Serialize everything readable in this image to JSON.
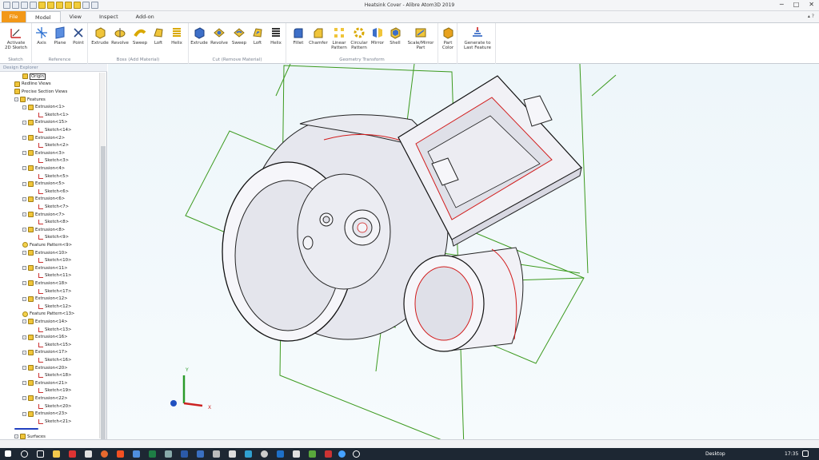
{
  "window": {
    "title": "Heatsink Cover - Alibre Atom3D 2019",
    "controls": {
      "minimize": "─",
      "maximize": "□",
      "close": "✕"
    }
  },
  "tabs": [
    {
      "label": "File"
    },
    {
      "label": "Model"
    },
    {
      "label": "View"
    },
    {
      "label": "Inspect"
    },
    {
      "label": "Add-on"
    }
  ],
  "ribbon": {
    "groups": [
      {
        "label": "Sketch",
        "buttons": [
          "Activate 2D Sketch"
        ]
      },
      {
        "label": "Reference",
        "buttons": [
          "Axis",
          "Plane",
          "Point"
        ]
      },
      {
        "label": "Boss (Add Material)",
        "buttons": [
          "Extrude",
          "Revolve",
          "Sweep",
          "Loft",
          "Helix"
        ]
      },
      {
        "label": "Cut (Remove Material)",
        "buttons": [
          "Extrude",
          "Revolve",
          "Sweep",
          "Loft",
          "Helix"
        ]
      },
      {
        "label": "Geometry Transform",
        "buttons": [
          "Fillet",
          "Chamfer",
          "Linear Pattern",
          "Circular Pattern",
          "Mirror",
          "Shell",
          "Scale/Mirror Part"
        ]
      },
      {
        "label": "",
        "buttons": [
          "Part Color"
        ]
      },
      {
        "label": "",
        "buttons": [
          "Generate to Last Feature"
        ]
      }
    ]
  },
  "explorer": {
    "header": "Design Explorer",
    "items": [
      {
        "label": "Origin",
        "type": "origin",
        "level": 2
      },
      {
        "label": "Redline Views",
        "type": "view",
        "level": 1
      },
      {
        "label": "Precise Section Views",
        "type": "view",
        "level": 1
      },
      {
        "label": "Features",
        "type": "folder",
        "level": 1
      },
      {
        "label": "Extrusion<1>",
        "type": "feat",
        "level": 2
      },
      {
        "label": "Sketch<1>",
        "type": "sk",
        "level": 3
      },
      {
        "label": "Extrusion<15>",
        "type": "feat",
        "level": 2
      },
      {
        "label": "Sketch<14>",
        "type": "sk",
        "level": 3
      },
      {
        "label": "Extrusion<2>",
        "type": "feat",
        "level": 2
      },
      {
        "label": "Sketch<2>",
        "type": "sk",
        "level": 3
      },
      {
        "label": "Extrusion<3>",
        "type": "feat",
        "level": 2
      },
      {
        "label": "Sketch<3>",
        "type": "sk",
        "level": 3
      },
      {
        "label": "Extrusion<4>",
        "type": "feat",
        "level": 2
      },
      {
        "label": "Sketch<5>",
        "type": "sk",
        "level": 3
      },
      {
        "label": "Extrusion<5>",
        "type": "feat",
        "level": 2
      },
      {
        "label": "Sketch<6>",
        "type": "sk",
        "level": 3
      },
      {
        "label": "Extrusion<6>",
        "type": "feat",
        "level": 2
      },
      {
        "label": "Sketch<7>",
        "type": "sk",
        "level": 3
      },
      {
        "label": "Extrusion<7>",
        "type": "feat",
        "level": 2
      },
      {
        "label": "Sketch<8>",
        "type": "sk",
        "level": 3
      },
      {
        "label": "Extrusion<8>",
        "type": "feat",
        "level": 2
      },
      {
        "label": "Sketch<9>",
        "type": "sk",
        "level": 3
      },
      {
        "label": "Feature Pattern<9>",
        "type": "pat",
        "level": 2
      },
      {
        "label": "Extrusion<10>",
        "type": "feat",
        "level": 2
      },
      {
        "label": "Sketch<10>",
        "type": "sk",
        "level": 3
      },
      {
        "label": "Extrusion<11>",
        "type": "feat",
        "level": 2
      },
      {
        "label": "Sketch<11>",
        "type": "sk",
        "level": 3
      },
      {
        "label": "Extrusion<18>",
        "type": "feat",
        "level": 2
      },
      {
        "label": "Sketch<17>",
        "type": "sk",
        "level": 3
      },
      {
        "label": "Extrusion<12>",
        "type": "feat",
        "level": 2
      },
      {
        "label": "Sketch<12>",
        "type": "sk",
        "level": 3
      },
      {
        "label": "Feature Pattern<13>",
        "type": "pat",
        "level": 2
      },
      {
        "label": "Extrusion<14>",
        "type": "feat",
        "level": 2
      },
      {
        "label": "Sketch<13>",
        "type": "sk",
        "level": 3
      },
      {
        "label": "Extrusion<16>",
        "type": "feat",
        "level": 2
      },
      {
        "label": "Sketch<15>",
        "type": "sk",
        "level": 3
      },
      {
        "label": "Extrusion<17>",
        "type": "feat",
        "level": 2
      },
      {
        "label": "Sketch<16>",
        "type": "sk",
        "level": 3
      },
      {
        "label": "Extrusion<20>",
        "type": "feat",
        "level": 2
      },
      {
        "label": "Sketch<18>",
        "type": "sk",
        "level": 3
      },
      {
        "label": "Extrusion<21>",
        "type": "feat",
        "level": 2
      },
      {
        "label": "Sketch<19>",
        "type": "sk",
        "level": 3
      },
      {
        "label": "Extrusion<22>",
        "type": "feat",
        "level": 2
      },
      {
        "label": "Sketch<20>",
        "type": "sk",
        "level": 3
      },
      {
        "label": "Extrusion<23>",
        "type": "feat",
        "level": 2
      },
      {
        "label": "Sketch<21>",
        "type": "sk",
        "level": 3
      },
      {
        "label": "",
        "type": "rollback",
        "level": 1
      },
      {
        "label": "Surfaces",
        "type": "folder",
        "level": 1
      }
    ]
  },
  "triad": {
    "y": "Y",
    "x": "X"
  },
  "taskbar": {
    "desktop": "Desktop",
    "time": "17:35"
  },
  "colors": {
    "file_tab": "#f29818",
    "sketch_green": "#3c9a1e",
    "edge_red": "#d21b1b",
    "taskbar": "#1d2733"
  }
}
